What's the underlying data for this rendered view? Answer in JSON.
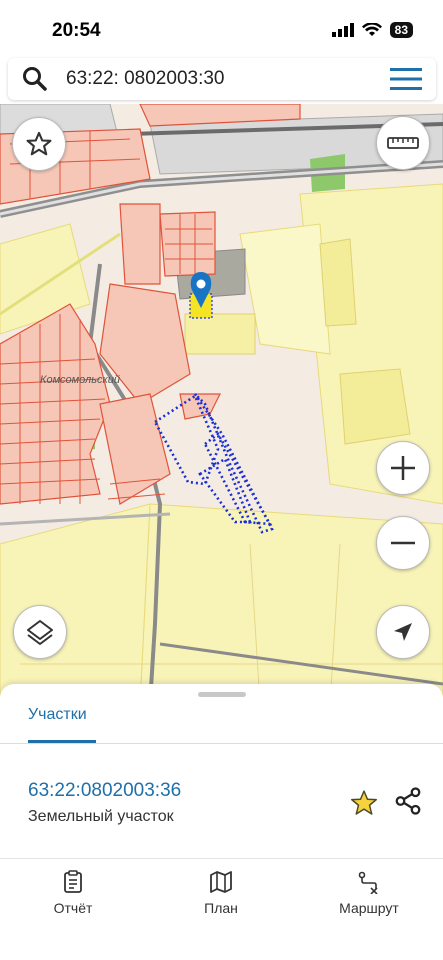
{
  "status_bar": {
    "time": "20:54",
    "battery": "83"
  },
  "search": {
    "query": "63:22: 0802003:30"
  },
  "map": {
    "place_label": "Комсомольский",
    "colors": {
      "parcel_fill": "#f6c7b6",
      "parcel_line": "#e0533a",
      "land": "#f8f4b8",
      "selection": "#1a2fd6",
      "marker": "#1975c4"
    }
  },
  "sheet": {
    "tab_label": "Участки",
    "parcel": {
      "number": "63:22:0802003:36",
      "type": "Земельный участок"
    }
  },
  "bottom_nav": {
    "report_label": "Отчёт",
    "plan_label": "План",
    "route_label": "Маршрут"
  }
}
